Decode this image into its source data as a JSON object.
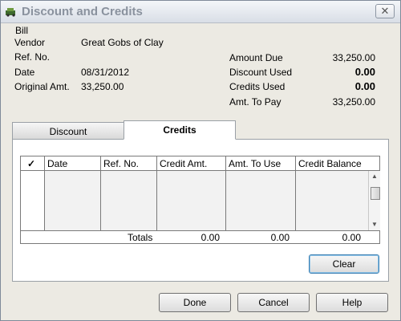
{
  "window": {
    "title": "Discount and Credits",
    "close_glyph": "✕"
  },
  "bill": {
    "section_label": "Bill",
    "vendor_label": "Vendor",
    "vendor": "Great Gobs of Clay",
    "ref_label": "Ref. No.",
    "ref": "",
    "date_label": "Date",
    "date": "08/31/2012",
    "orig_label": "Original Amt.",
    "orig": "33,250.00",
    "amount_due_label": "Amount Due",
    "amount_due": "33,250.00",
    "discount_used_label": "Discount Used",
    "discount_used": "0.00",
    "credits_used_label": "Credits Used",
    "credits_used": "0.00",
    "amt_to_pay_label": "Amt. To Pay",
    "amt_to_pay": "33,250.00"
  },
  "tabs": [
    {
      "label": "Discount",
      "active": false
    },
    {
      "label": "Credits",
      "active": true
    }
  ],
  "credits_table": {
    "columns": [
      "✓",
      "Date",
      "Ref. No.",
      "Credit Amt.",
      "Amt. To Use",
      "Credit Balance"
    ],
    "rows": [],
    "totals": {
      "label": "Totals",
      "credit_amt": "0.00",
      "amt_to_use": "0.00",
      "credit_balance": "0.00"
    }
  },
  "buttons": {
    "clear": "Clear",
    "done": "Done",
    "cancel": "Cancel",
    "help": "Help"
  },
  "icons": {
    "app": "bill-icon",
    "scroll_up": "▲",
    "scroll_down": "▼"
  },
  "colors": {
    "dialog_bg": "#eceae3",
    "title_text": "#8a929e",
    "focus_border": "#3c7fb1"
  }
}
